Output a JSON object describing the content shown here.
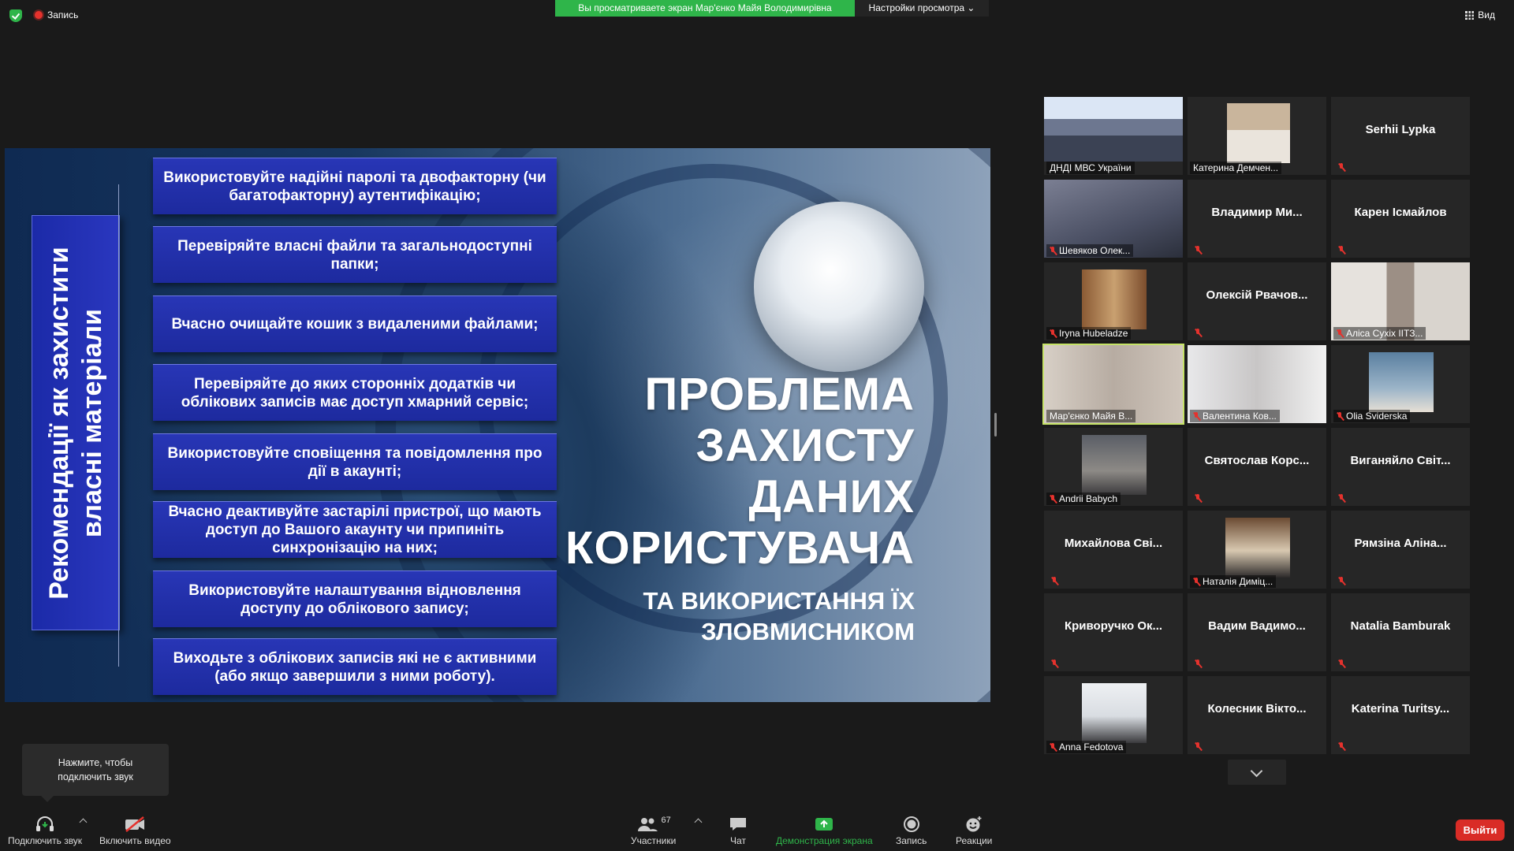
{
  "topbar": {
    "recording_label": "Запись",
    "share_banner": "Вы просматриваете экран Мар'єнко Майя Володимирівна",
    "view_options_label": "Настройки просмотра",
    "view_label": "Вид"
  },
  "slide": {
    "vertical_title": "Рекомендації як захистити власні матеріали",
    "recommendations": [
      "Використовуйте надійні паролі та двофакторну (чи багатофакторну) аутентифікацію;",
      "Перевіряйте власні файли та загальнодоступні папки;",
      "Вчасно очищайте кошик з видаленими файлами;",
      "Перевіряйте до яких сторонніх додатків чи облікових записів має доступ хмарний сервіс;",
      "Використовуйте сповіщення та повідомлення про дії в акаунті;",
      "Вчасно деактивуйте застарілі пристрої, що мають доступ до Вашого акаунту чи припиніть синхронізацію на них;",
      "Використовуйте налаштування відновлення доступу до облікового запису;",
      "Виходьте з облікових записів які не є активними (або якщо завершили з ними роботу)."
    ],
    "title_lines": [
      "ПРОБЛЕМА",
      "ЗАХИСТУ",
      "ДАНИХ",
      "КОРИСТУВАЧА"
    ],
    "subtitle_lines": [
      "ТА ВИКОРИСТАННЯ ЇХ",
      "ЗЛОВМИСНИКОМ"
    ]
  },
  "participants": [
    {
      "name": "ДНДІ МВС України",
      "video": true,
      "muted": false
    },
    {
      "name": "Катерина Демчен...",
      "video": true,
      "muted": false
    },
    {
      "name": "Serhii Lypka",
      "video": false,
      "muted": true
    },
    {
      "name": "Шевяков Олек...",
      "video": true,
      "muted": true
    },
    {
      "name": "Владимир  Ми...",
      "video": false,
      "muted": true
    },
    {
      "name": "Карен Ісмайлов",
      "video": false,
      "muted": true
    },
    {
      "name": "Iryna Hubeladze",
      "video": true,
      "muted": true
    },
    {
      "name": "Олексій Рвачов...",
      "video": false,
      "muted": true
    },
    {
      "name": "Аліса Сухіх ІІТЗ...",
      "video": true,
      "muted": true
    },
    {
      "name": "Мар'єнко Майя В...",
      "video": true,
      "muted": false,
      "active": true
    },
    {
      "name": "Валентина Ков...",
      "video": true,
      "muted": true
    },
    {
      "name": "Olia Sviderska",
      "video": true,
      "muted": true
    },
    {
      "name": "Andrii Babych",
      "video": true,
      "muted": true
    },
    {
      "name": "Святослав  Корс...",
      "video": false,
      "muted": true
    },
    {
      "name": "Виганяйло  Світ...",
      "video": false,
      "muted": true
    },
    {
      "name": "Михайлова  Сві...",
      "video": false,
      "muted": true
    },
    {
      "name": "Наталія Диміц...",
      "video": true,
      "muted": true
    },
    {
      "name": "Рямзіна  Аліна...",
      "video": false,
      "muted": true
    },
    {
      "name": "Криворучко  Ок...",
      "video": false,
      "muted": true
    },
    {
      "name": "Вадим  Вадимо...",
      "video": false,
      "muted": true
    },
    {
      "name": "Natalia Bamburak",
      "video": false,
      "muted": true
    },
    {
      "name": "Anna Fedotova",
      "video": true,
      "muted": true
    },
    {
      "name": "Колесник  Вікто...",
      "video": false,
      "muted": true
    },
    {
      "name": "Katerina  Turitsy...",
      "video": false,
      "muted": true
    }
  ],
  "tooltip": {
    "text_line1": "Нажмите, чтобы",
    "text_line2": "подключить звук"
  },
  "toolbar": {
    "audio_label": "Подключить звук",
    "video_label": "Включить видео",
    "participants_label": "Участники",
    "participants_count": "67",
    "chat_label": "Чат",
    "share_label": "Демонстрация экрана",
    "record_label": "Запись",
    "reactions_label": "Реакции",
    "exit_label": "Выйти"
  },
  "colors": {
    "share_green": "#2fb54a",
    "active_speaker": "#c6e368",
    "exit_red": "#d92c26",
    "slide_box_blue": "#2332b0"
  }
}
